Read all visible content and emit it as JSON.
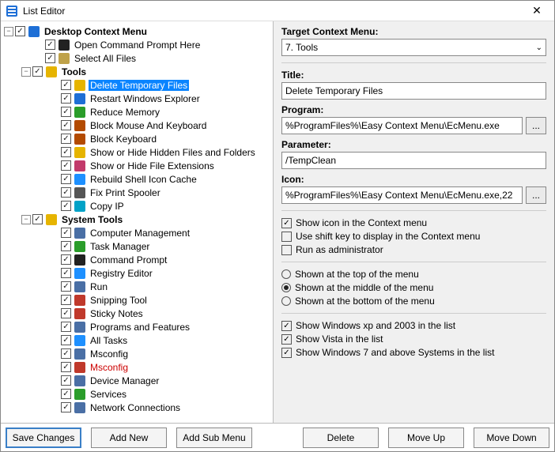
{
  "window": {
    "title": "List Editor"
  },
  "tree": {
    "root": {
      "label": "Desktop Context Menu",
      "items": [
        {
          "label": "Open Command Prompt Here",
          "icon": "cmd-icon",
          "iconColor": "#222"
        },
        {
          "label": "Select All Files",
          "icon": "files-icon",
          "iconColor": "#bfa24a"
        }
      ],
      "groups": [
        {
          "label": "Tools",
          "items": [
            {
              "label": "Delete Temporary Files",
              "icon": "broom-icon",
              "iconColor": "#e6b400",
              "selected": true
            },
            {
              "label": "Restart Windows Explorer",
              "icon": "refresh-icon",
              "iconColor": "#1e6fd6"
            },
            {
              "label": "Reduce Memory",
              "icon": "chip-icon",
              "iconColor": "#2a9d2a"
            },
            {
              "label": "Block Mouse And Keyboard",
              "icon": "block-icon",
              "iconColor": "#b34a00"
            },
            {
              "label": "Block Keyboard",
              "icon": "keyboard-icon",
              "iconColor": "#b34a00"
            },
            {
              "label": "Show or Hide Hidden Files and Folders",
              "icon": "folder-icon",
              "iconColor": "#e6b400"
            },
            {
              "label": "Show or Hide File Extensions",
              "icon": "ext-icon",
              "iconColor": "#c23a6b"
            },
            {
              "label": "Rebuild Shell Icon Cache",
              "icon": "rebuild-icon",
              "iconColor": "#1e90ff"
            },
            {
              "label": "Fix Print Spooler",
              "icon": "printer-icon",
              "iconColor": "#555"
            },
            {
              "label": "Copy IP",
              "icon": "ip-icon",
              "iconColor": "#00a2c7"
            }
          ]
        },
        {
          "label": "System Tools",
          "items": [
            {
              "label": "Computer Management",
              "icon": "mgmt-icon",
              "iconColor": "#4a6fa5"
            },
            {
              "label": "Task Manager",
              "icon": "task-icon",
              "iconColor": "#2a9d2a"
            },
            {
              "label": "Command Prompt",
              "icon": "cmd-icon",
              "iconColor": "#222"
            },
            {
              "label": "Registry Editor",
              "icon": "reg-icon",
              "iconColor": "#1e90ff"
            },
            {
              "label": "Run",
              "icon": "run-icon",
              "iconColor": "#4a6fa5"
            },
            {
              "label": "Snipping Tool",
              "icon": "snip-icon",
              "iconColor": "#c0392b"
            },
            {
              "label": "Sticky Notes",
              "icon": "note-icon",
              "iconColor": "#c0392b"
            },
            {
              "label": "Programs and Features",
              "icon": "prog-icon",
              "iconColor": "#4a6fa5"
            },
            {
              "label": "All Tasks",
              "icon": "tasks-icon",
              "iconColor": "#1e90ff"
            },
            {
              "label": "Msconfig",
              "icon": "cfg-icon",
              "iconColor": "#4a6fa5"
            },
            {
              "label": "Msconfig",
              "icon": "cfg-red-icon",
              "iconColor": "#c0392b",
              "red": true
            },
            {
              "label": "Device Manager",
              "icon": "dev-icon",
              "iconColor": "#4a6fa5"
            },
            {
              "label": "Services",
              "icon": "svc-icon",
              "iconColor": "#2a9d2a"
            },
            {
              "label": "Network Connections",
              "icon": "net-icon",
              "iconColor": "#4a6fa5"
            }
          ]
        }
      ]
    }
  },
  "form": {
    "targetLabel": "Target Context Menu:",
    "targetValue": "7. Tools",
    "titleLabel": "Title:",
    "titleValue": "Delete Temporary Files",
    "programLabel": "Program:",
    "programValue": "%ProgramFiles%\\Easy Context Menu\\EcMenu.exe",
    "paramLabel": "Parameter:",
    "paramValue": "/TempClean",
    "iconLabel": "Icon:",
    "iconValue": "%ProgramFiles%\\Easy Context Menu\\EcMenu.exe,22",
    "browse": "...",
    "opts1": [
      {
        "label": "Show icon in the Context menu",
        "checked": true
      },
      {
        "label": "Use shift key to display in the Context menu",
        "checked": false
      },
      {
        "label": "Run as administrator",
        "checked": false
      }
    ],
    "pos": [
      {
        "label": "Shown at the top of the menu",
        "checked": false
      },
      {
        "label": "Shown at the middle of the menu",
        "checked": true
      },
      {
        "label": "Shown at the bottom of the menu",
        "checked": false
      }
    ],
    "opts2": [
      {
        "label": "Show Windows xp  and 2003 in the list",
        "checked": true
      },
      {
        "label": "Show Vista in the list",
        "checked": true
      },
      {
        "label": "Show Windows 7 and above Systems in the list",
        "checked": true
      }
    ]
  },
  "buttons": {
    "save": "Save Changes",
    "add": "Add New",
    "addSub": "Add Sub Menu",
    "delete": "Delete",
    "moveUp": "Move Up",
    "moveDown": "Move Down"
  }
}
